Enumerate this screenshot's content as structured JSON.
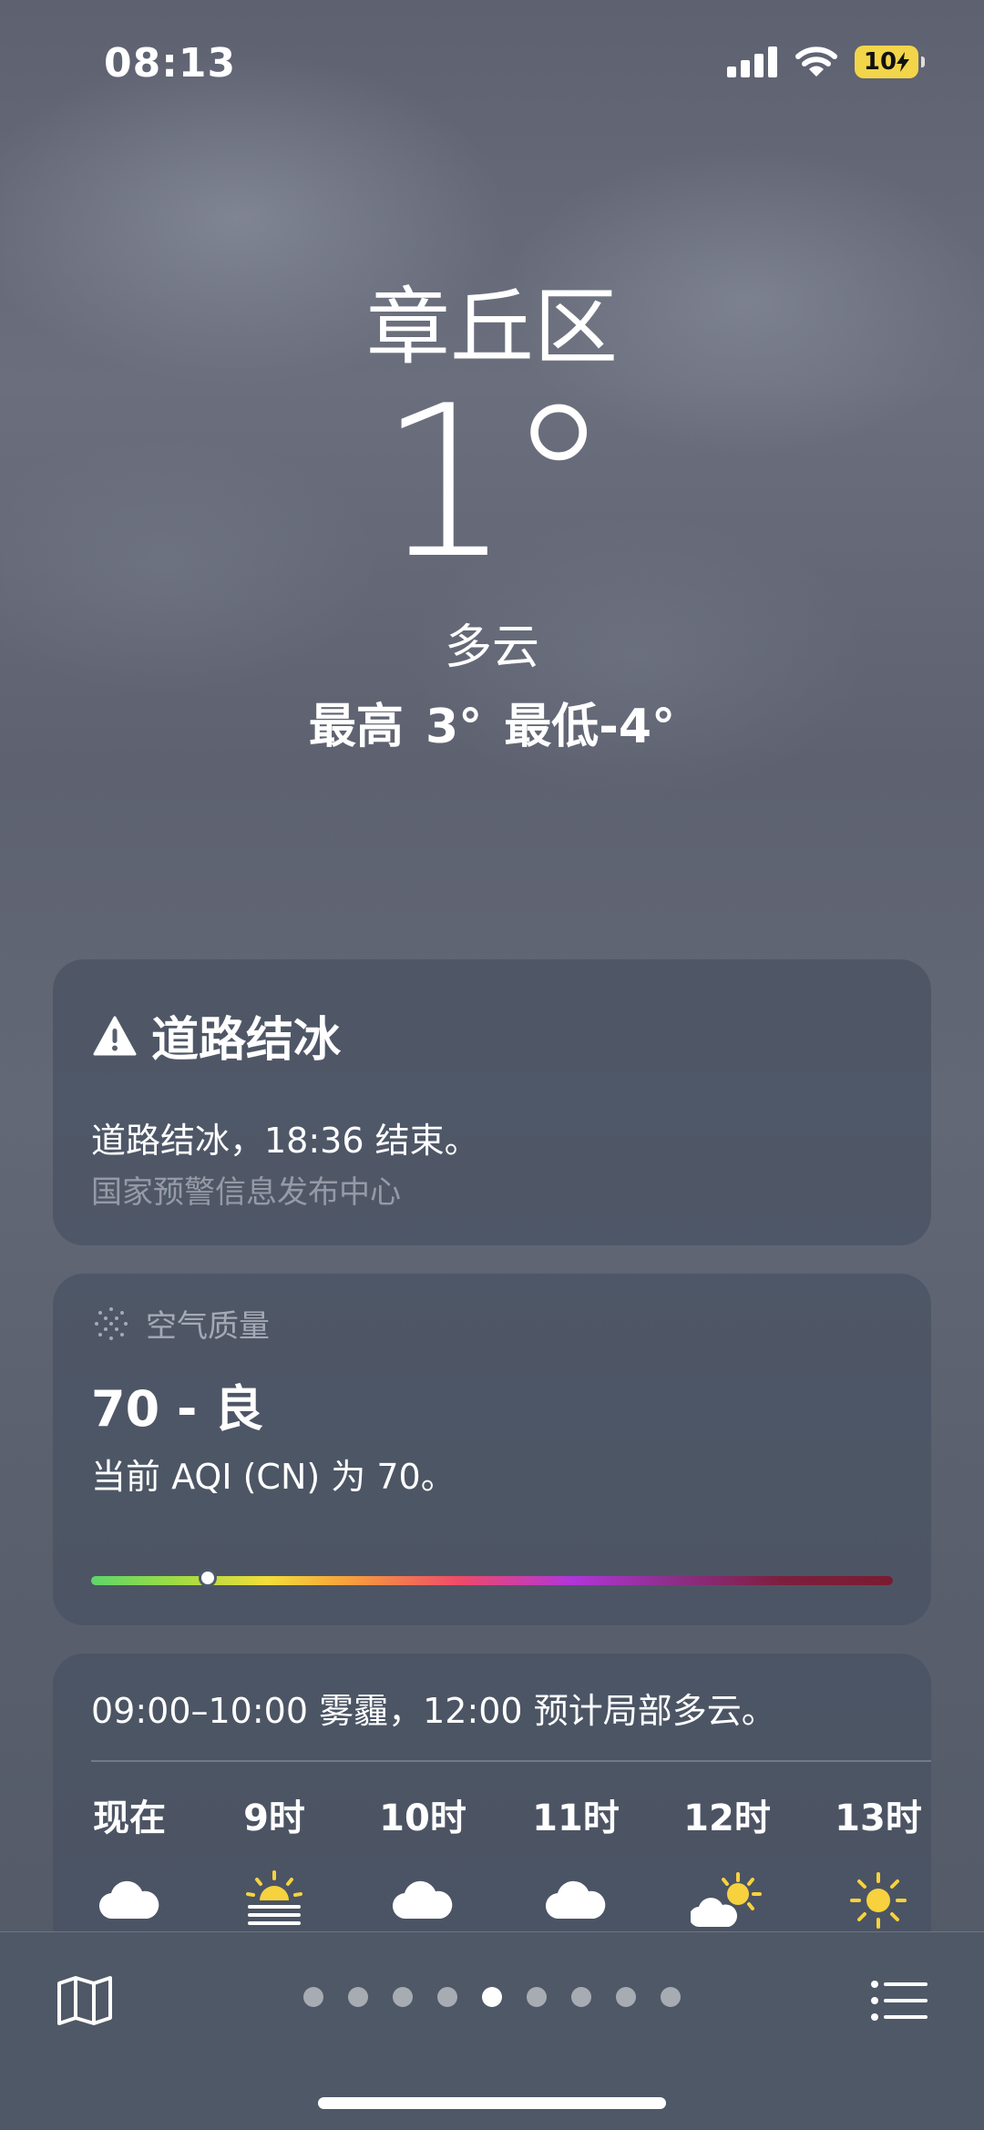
{
  "status": {
    "time": "08:13",
    "battery": "10",
    "battery_color": "#f3d54a"
  },
  "hero": {
    "city": "章丘区",
    "temperature": "1°",
    "condition": "多云",
    "high_low": "最高 3°  最低-4°"
  },
  "alert": {
    "title": "道路结冰",
    "description": "道路结冰，18:36 结束。",
    "source": "国家预警信息发布中心",
    "icon": "warning-triangle-icon"
  },
  "air_quality": {
    "header": "空气质量",
    "value_label": "70 - 良",
    "description": "当前 AQI (CN) 为 70。",
    "indicator_fraction": 0.145,
    "icon": "air-quality-icon"
  },
  "hourly": {
    "summary": "09:00–10:00 雾霾，12:00 预计局部多云。",
    "hours": [
      {
        "label": "现在",
        "icon": "cloud-icon"
      },
      {
        "label": "9时",
        "icon": "sun-haze-icon"
      },
      {
        "label": "10时",
        "icon": "cloud-icon"
      },
      {
        "label": "11时",
        "icon": "cloud-icon"
      },
      {
        "label": "12时",
        "icon": "partly-cloudy-icon"
      },
      {
        "label": "13时",
        "icon": "sun-icon"
      }
    ]
  },
  "bottom_bar": {
    "page_count": 9,
    "active_page": 5,
    "map_icon": "map-icon",
    "list_icon": "list-icon"
  }
}
